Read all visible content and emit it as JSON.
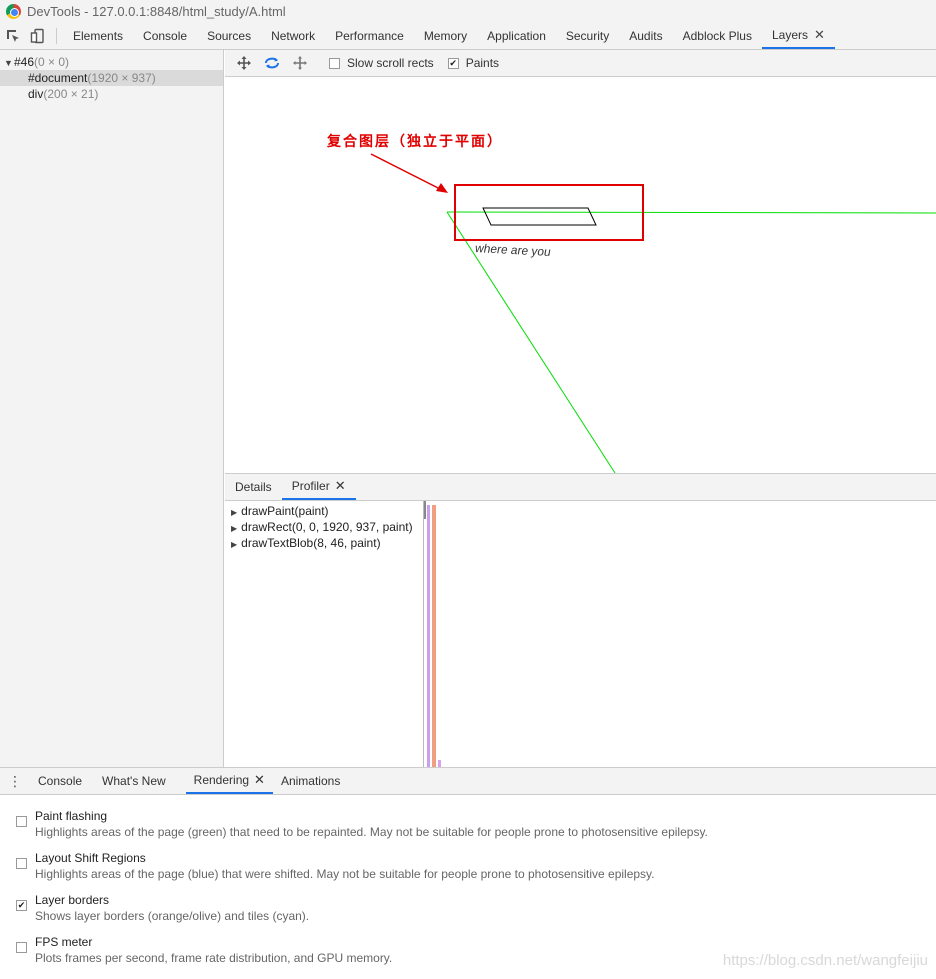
{
  "window": {
    "title": "DevTools - 127.0.0.1:8848/html_study/A.html"
  },
  "main_tabs": [
    {
      "label": "Elements"
    },
    {
      "label": "Console"
    },
    {
      "label": "Sources"
    },
    {
      "label": "Network"
    },
    {
      "label": "Performance"
    },
    {
      "label": "Memory"
    },
    {
      "label": "Application"
    },
    {
      "label": "Security"
    },
    {
      "label": "Audits"
    },
    {
      "label": "Adblock Plus"
    },
    {
      "label": "Layers",
      "active": true
    }
  ],
  "close_glyph": "✕",
  "layer_tree": [
    {
      "name": "#46",
      "size": "(0 × 0)"
    },
    {
      "name": "#document",
      "size": "(1920 × 937)"
    },
    {
      "name": "div",
      "size": "(200 × 21)"
    }
  ],
  "layers_toolbar": {
    "slow_scroll_label": "Slow scroll rects",
    "slow_scroll_checked": false,
    "paints_label": "Paints",
    "paints_checked": true
  },
  "canvas": {
    "annotation": "复合图层（独立于平面）",
    "layer_text": "where are you",
    "annotation_color": "#e00000",
    "layer_border_color": "#00e000"
  },
  "detail_tabs": [
    {
      "label": "Details"
    },
    {
      "label": "Profiler",
      "active": true
    }
  ],
  "profiler_commands": [
    {
      "label": "drawPaint(paint)"
    },
    {
      "label": "drawRect(0, 0, 1920, 937, paint)"
    },
    {
      "label": "drawTextBlob(8, 46, paint)"
    }
  ],
  "drawer_tabs": [
    {
      "label": "Console"
    },
    {
      "label": "What's New"
    },
    {
      "label": "Rendering",
      "active": true
    },
    {
      "label": "Animations"
    }
  ],
  "rendering_options": [
    {
      "title": "Paint flashing",
      "desc": "Highlights areas of the page (green) that need to be repainted. May not be suitable for people prone to photosensitive epilepsy.",
      "checked": false
    },
    {
      "title": "Layout Shift Regions",
      "desc": "Highlights areas of the page (blue) that were shifted. May not be suitable for people prone to photosensitive epilepsy.",
      "checked": false
    },
    {
      "title": "Layer borders",
      "desc": "Shows layer borders (orange/olive) and tiles (cyan).",
      "checked": true
    },
    {
      "title": "FPS meter",
      "desc": "Plots frames per second, frame rate distribution, and GPU memory.",
      "checked": false
    }
  ],
  "watermark": "https://blog.csdn.net/wangfeijiu",
  "check_glyph": "✔"
}
